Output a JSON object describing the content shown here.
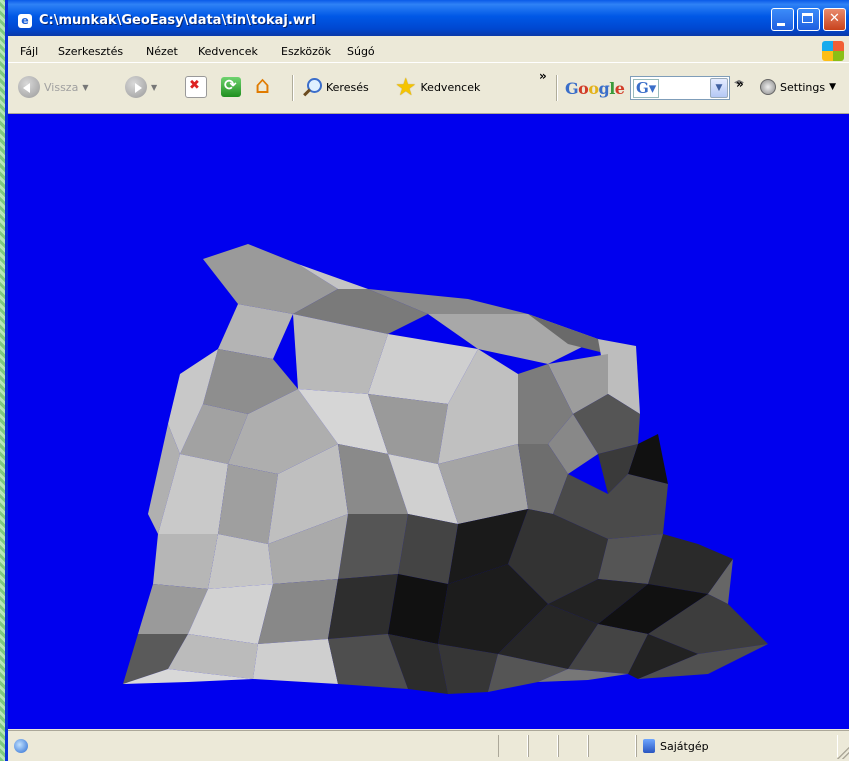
{
  "window": {
    "title": "C:\\munkak\\GeoEasy\\data\\tin\\tokaj.wrl"
  },
  "menu": {
    "items": [
      {
        "label": "Fájl"
      },
      {
        "label": "Szerkesztés"
      },
      {
        "label": "Nézet"
      },
      {
        "label": "Kedvencek"
      },
      {
        "label": "Eszközök"
      },
      {
        "label": "Súgó"
      }
    ]
  },
  "toolbar": {
    "back_label": "Vissza",
    "search_label": "Keresés",
    "favorites_label": "Kedvencek",
    "more": "»",
    "google": {
      "G1": "G",
      "o1": "o",
      "o2": "o",
      "g": "g",
      "l": "l",
      "e": "e"
    },
    "google_box_icon": "G▾",
    "google_more": "»",
    "settings_label": "Settings"
  },
  "status": {
    "zone": "Sajátgép"
  },
  "scene": {
    "background": "#0000ee",
    "model": "3D TIN terrain (grayscale shaded triangles)"
  },
  "colors": {
    "title_blue": "#0058e6",
    "chrome": "#ece9d8",
    "viewport_bg": "#0000ee"
  }
}
